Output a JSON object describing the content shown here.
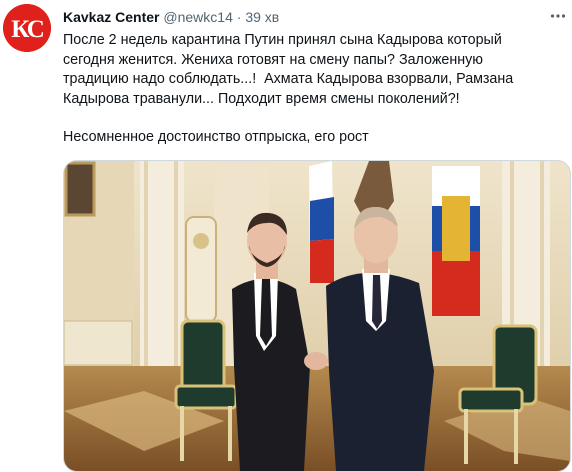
{
  "tweet": {
    "author": {
      "name": "Kavkaz Center",
      "handle": "@newkc14",
      "avatar_text": "КС"
    },
    "separator": "·",
    "time": "39 хв",
    "text_p1": "После 2 недель карантина Путин принял сына Кадырова который сегодня женится. Жениха готовят на смену папы? Заложенную традицию надо соблюдать...!  Ахмата Кадырова взорвали, Рамзана Кадырова траванули... Подходит время смены поколений?!",
    "text_p2": "Несомненное достоинство отпрыска, его рост",
    "more_icon": "ellipsis-icon",
    "media_icon": "photo-icon"
  },
  "colors": {
    "avatar_red": "#e0201b",
    "name_text": "#0f1419",
    "meta_text": "#536471",
    "media_border": "#cfd9de"
  }
}
